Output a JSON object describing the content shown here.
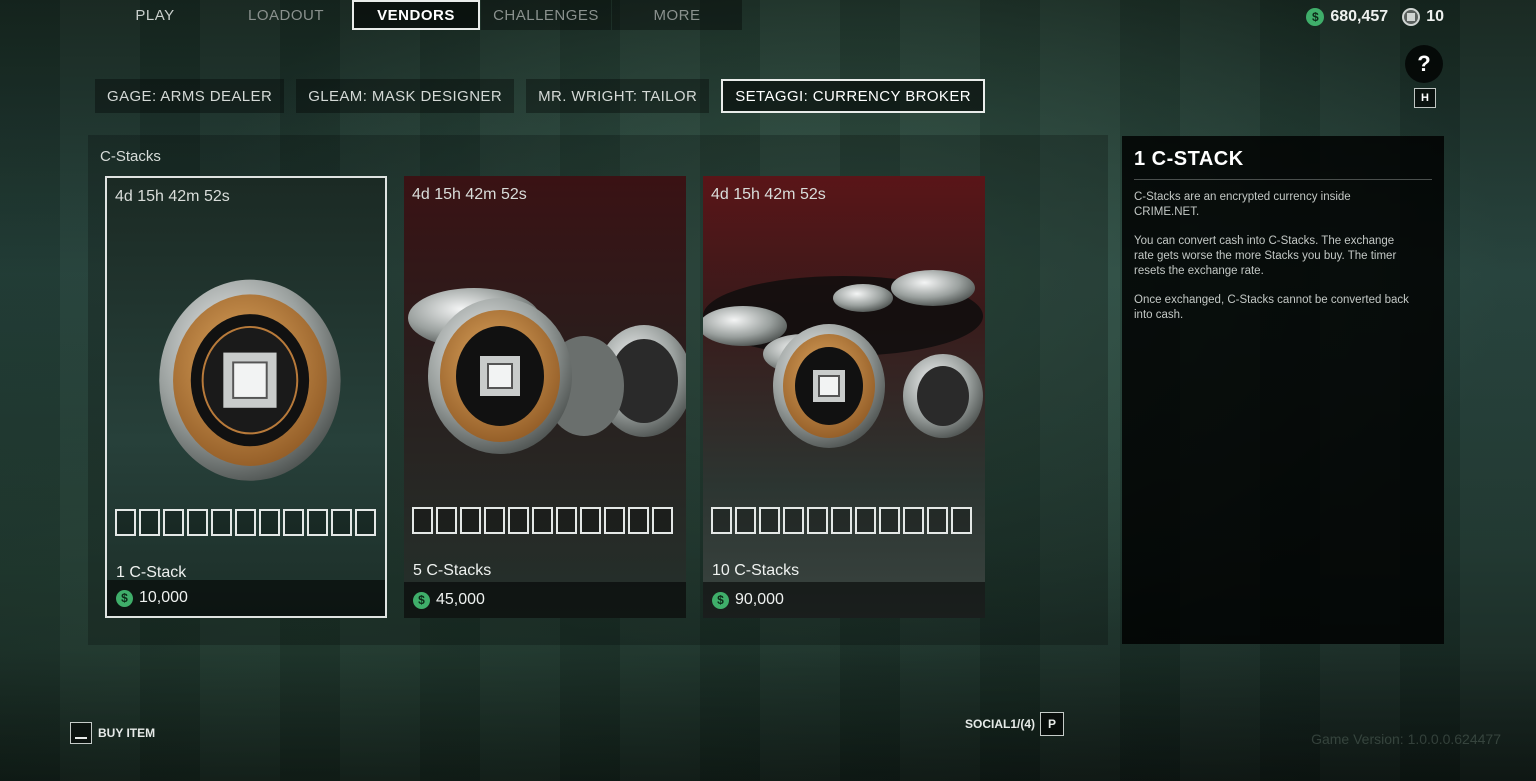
{
  "top_nav": {
    "tabs": [
      {
        "label": "PLAY",
        "active": false
      },
      {
        "label": "LOADOUT",
        "active": false
      },
      {
        "label": "VENDORS",
        "active": true
      },
      {
        "label": "CHALLENGES",
        "active": false
      },
      {
        "label": "MORE",
        "active": false
      }
    ]
  },
  "currency": {
    "cash_symbol": "$",
    "cash": "680,457",
    "c_stacks": "10"
  },
  "help": {
    "label": "?",
    "key": "H"
  },
  "vendor_tabs": [
    {
      "label": "GAGE: ARMS DEALER",
      "active": false
    },
    {
      "label": "GLEAM: MASK DESIGNER",
      "active": false
    },
    {
      "label": "MR. WRIGHT: TAILOR",
      "active": false
    },
    {
      "label": "SETAGGI: CURRENCY BROKER",
      "active": true
    }
  ],
  "section_title": "C-Stacks",
  "cards": [
    {
      "timer": "4d 15h 42m 52s",
      "name": "1 C-Stack",
      "price": "10,000",
      "selected": true,
      "slots": 11
    },
    {
      "timer": "4d 15h 42m 52s",
      "name": "5 C-Stacks",
      "price": "45,000",
      "selected": false,
      "slots": 11
    },
    {
      "timer": "4d 15h 42m 52s",
      "name": "10 C-Stacks",
      "price": "90,000",
      "selected": false,
      "slots": 11
    }
  ],
  "info": {
    "title": "1 C-STACK",
    "paragraphs": [
      "C-Stacks are an encrypted currency inside CRIME.NET.",
      "You can convert cash into C-Stacks. The exchange rate gets worse the more Stacks you buy. The timer resets the exchange rate.",
      "Once exchanged, C-Stacks cannot be converted back into cash."
    ]
  },
  "footer": {
    "buy_label": "BUY ITEM",
    "social_label": "SOCIAL",
    "social_count": "1/(4)",
    "social_key": "P",
    "version": "Game Version: 1.0.0.0.624477"
  },
  "colors": {
    "cash_green": "#3fae6a",
    "highlight_border": "#e9ecea",
    "background": "#1e352e"
  }
}
